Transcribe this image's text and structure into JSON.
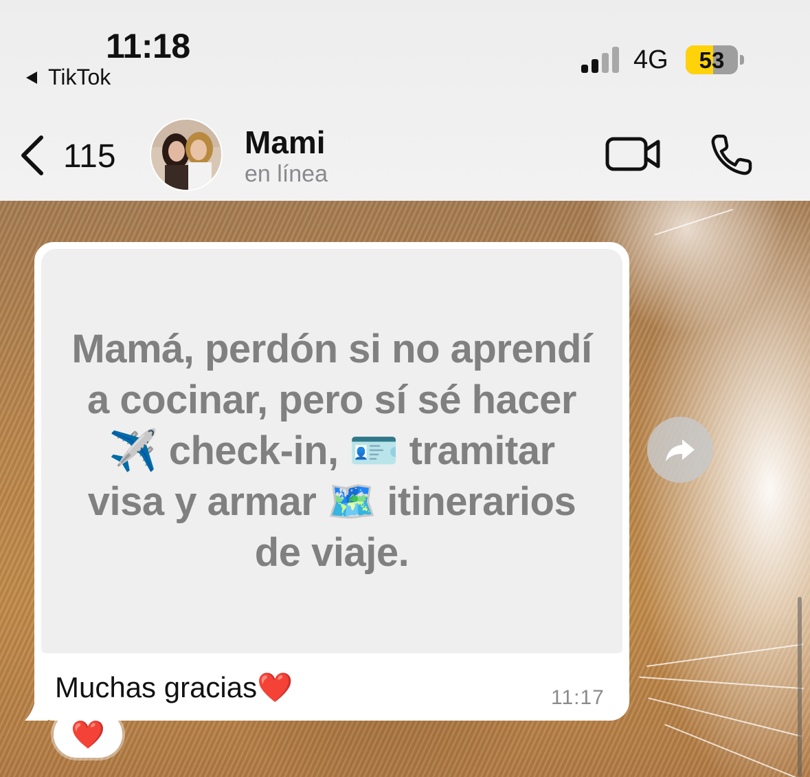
{
  "status_bar": {
    "time": "11:18",
    "back_app_label": "TikTok",
    "network": "4G",
    "battery_level": "53",
    "battery_fraction": 0.53,
    "signal_bars_active": 2,
    "signal_bars_total": 4
  },
  "header": {
    "unread_count": "115",
    "contact_name": "Mami",
    "contact_status": "en línea"
  },
  "message": {
    "media_text": "Mamá, perdón si no aprendí a cocinar, pero sí sé hacer ✈️ check-in, 🪪 tramitar visa y armar 🗺️ itinerarios de viaje.",
    "caption": "Muchas gracias❤️",
    "time": "11:17",
    "reaction": "❤️"
  },
  "icons": {
    "back": "chevron-left-icon",
    "video": "video-camera-icon",
    "call": "phone-icon",
    "forward": "forward-arrow-icon"
  },
  "colors": {
    "battery_fill": "#ffd20a",
    "status_text": "#8a8a8e",
    "media_text": "#808080",
    "bubble": "#ffffff"
  }
}
